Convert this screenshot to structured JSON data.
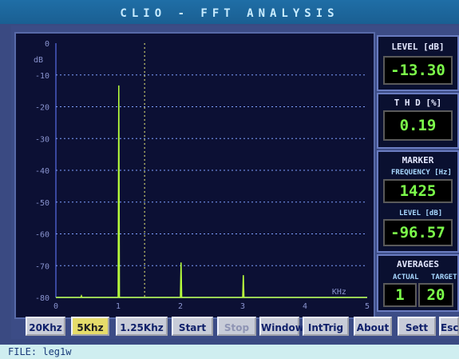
{
  "window": {
    "title": "CLIO - FFT  ANALYSIS"
  },
  "chart_data": {
    "type": "line",
    "ylabel": "dB",
    "xlabel": "KHz",
    "ylim": [
      -80,
      0
    ],
    "xlim": [
      0,
      5
    ],
    "y_ticks": [
      "0",
      "-10",
      "-20",
      "-30",
      "-40",
      "-50",
      "-60",
      "-70",
      "-80"
    ],
    "x_ticks": [
      "0",
      "1",
      "2",
      "3",
      "4",
      "5"
    ],
    "grid": true,
    "marker_khz": 1.425,
    "series": [
      {
        "x": [
          0.0,
          0.4,
          0.41,
          0.42,
          1.0,
          1.01,
          1.02,
          2.0,
          2.01,
          2.02,
          3.0,
          3.01,
          3.02,
          5.0
        ],
        "y": [
          -80,
          -80,
          -79.5,
          -80,
          -80,
          -13.3,
          -80,
          -80,
          -69,
          -80,
          -80,
          -73,
          -80,
          -80
        ]
      }
    ],
    "colors": {
      "trace": "#b8ff3c",
      "grid": "#7fa0ff",
      "marker": "#f2f27a"
    }
  },
  "level": {
    "title": "LEVEL [dB]",
    "value": "-13.30"
  },
  "thd": {
    "title": "T H D [%]",
    "value": "0.19"
  },
  "marker": {
    "title": "MARKER",
    "freq_label": "FREQUENCY [Hz]",
    "freq_value": "1425",
    "level_label": "LEVEL [dB]",
    "level_value": "-96.57"
  },
  "averages": {
    "title": "AVERAGES",
    "actual_label": "ACTUAL",
    "target_label": "TARGET",
    "actual_value": "1",
    "target_value": "20"
  },
  "buttons": {
    "b20k": "20Khz",
    "b5k": "5Khz",
    "b125k": "1.25Khz",
    "start": "Start",
    "stop": "Stop",
    "window": "Window",
    "inttrig": "IntTrig",
    "about": "About",
    "sett": "Sett",
    "esc": "Esc"
  },
  "status": {
    "file": "FILE:  leg1w"
  }
}
